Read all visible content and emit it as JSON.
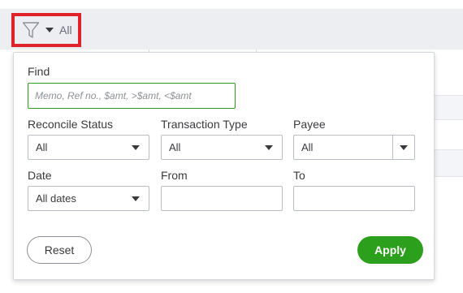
{
  "filter_trigger": {
    "icon": "funnel-icon",
    "caret_icon": "caret-down-icon",
    "label": "All",
    "highlight_color": "#e0232b"
  },
  "filter_panel": {
    "find": {
      "label": "Find",
      "value": "",
      "placeholder": "Memo, Ref no., $amt, >$amt, <$amt",
      "focus_color": "#2ca01c"
    },
    "reconcile_status": {
      "label": "Reconcile Status",
      "selected": "All"
    },
    "transaction_type": {
      "label": "Transaction Type",
      "selected": "All"
    },
    "payee": {
      "label": "Payee",
      "selected": "All"
    },
    "date": {
      "label": "Date",
      "selected": "All dates"
    },
    "from": {
      "label": "From",
      "value": ""
    },
    "to": {
      "label": "To",
      "value": ""
    },
    "reset_label": "Reset",
    "apply_label": "Apply",
    "apply_color": "#2ca01c"
  }
}
